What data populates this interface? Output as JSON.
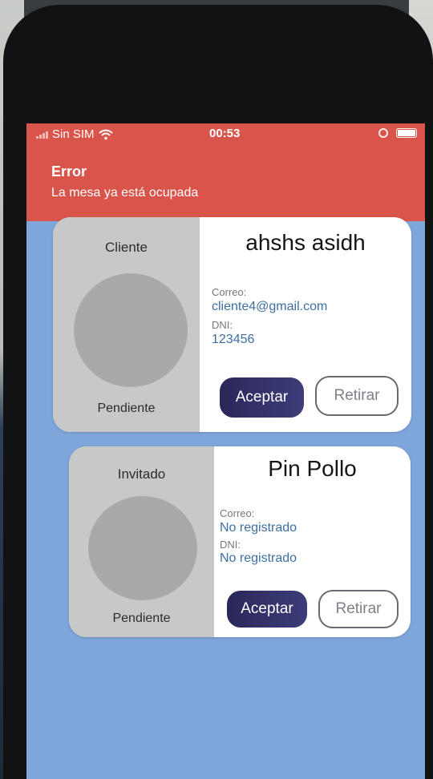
{
  "status_bar": {
    "carrier": "Sin SIM",
    "time": "00:53"
  },
  "alert": {
    "title": "Error",
    "message": "La mesa ya está ocupada"
  },
  "cards": [
    {
      "role": "Cliente",
      "state": "Pendiente",
      "name": "ahshs asidh",
      "email_label": "Correo:",
      "email": "cliente4@gmail.com",
      "dni_label": "DNI:",
      "dni": "123456",
      "accept_label": "Aceptar",
      "retire_label": "Retirar"
    },
    {
      "role": "Invitado",
      "state": "Pendiente",
      "name": "Pin Pollo",
      "email_label": "Correo:",
      "email": "No registrado",
      "dni_label": "DNI:",
      "dni": "No registrado",
      "accept_label": "Aceptar",
      "retire_label": "Retirar"
    }
  ],
  "colors": {
    "alert_bg": "#d9544b",
    "screen_bg": "#7ea6da",
    "accept_bg": "#2f2c58",
    "link_text": "#3d6fa3"
  }
}
